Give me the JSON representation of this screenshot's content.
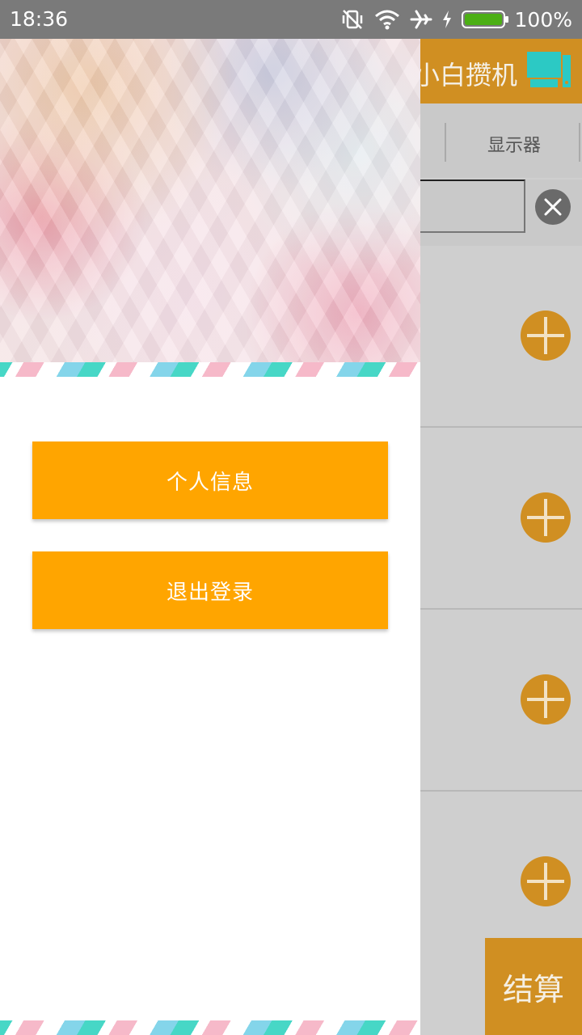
{
  "status_bar": {
    "time": "18:36",
    "battery_percent": "100%",
    "battery_level": 1.0,
    "icons": [
      "vibrate-off-icon",
      "wifi-icon",
      "airplane-icon",
      "charging-icon",
      "battery-icon"
    ]
  },
  "app": {
    "title": "小白攒机",
    "logo_icon": "computer-icon",
    "tabs": [
      {
        "label": "显示器"
      }
    ],
    "search": {
      "value": "",
      "placeholder": ""
    },
    "list_item_count": 4,
    "checkout_label": "结算"
  },
  "drawer": {
    "header_image": "low-poly-pink-pattern",
    "buttons": [
      {
        "label": "个人信息"
      },
      {
        "label": "退出登录"
      }
    ]
  },
  "colors": {
    "toolbar": "#d08f22",
    "drawer_button": "#ffa500",
    "status_bar": "#7a7a7a",
    "logo": "#2cc9c4",
    "battery": "#4caf14"
  }
}
